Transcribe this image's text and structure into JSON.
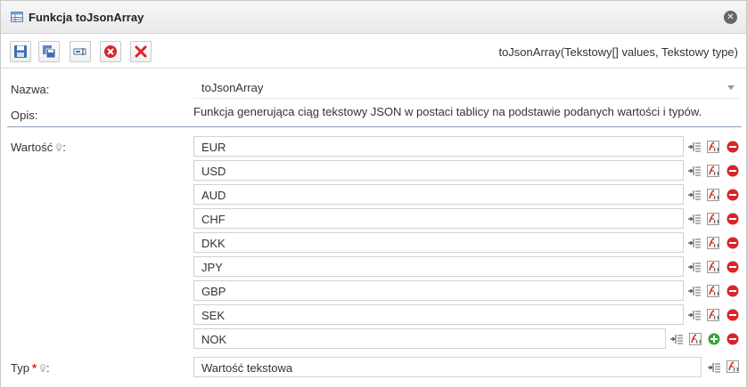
{
  "window": {
    "title": "Funkcja toJsonArray",
    "icon": "table-icon",
    "close_icon": "close-icon"
  },
  "toolbar": {
    "buttons": [
      {
        "name": "save-button",
        "icon": "floppy-icon"
      },
      {
        "name": "save-copy-button",
        "icon": "copy-icon"
      },
      {
        "name": "rename-button",
        "icon": "textfield-icon"
      },
      {
        "name": "cancel-button",
        "icon": "red-circle-x-icon"
      },
      {
        "name": "delete-button",
        "icon": "red-x-icon"
      }
    ],
    "signature": "toJsonArray(Tekstowy[] values, Tekstowy type)"
  },
  "form": {
    "nazwa_label": "Nazwa:",
    "nazwa_value": "toJsonArray",
    "opis_label": "Opis:",
    "opis_value": "Funkcja generująca ciąg tekstowy JSON w postaci tablicy na podstawie podanych wartości i typów.",
    "wartosc_label": "Wartość",
    "wartosc_colon": ":",
    "values": [
      "EUR",
      "USD",
      "AUD",
      "CHF",
      "DKK",
      "JPY",
      "GBP",
      "SEK",
      "NOK"
    ],
    "typ_label": "Typ",
    "typ_required": "*",
    "typ_colon": ":",
    "typ_value": "Wartość tekstowa"
  },
  "colors": {
    "separator": "#8aa0b8",
    "remove": "#d9242a",
    "add": "#3aa43a",
    "required": "#e02020"
  }
}
